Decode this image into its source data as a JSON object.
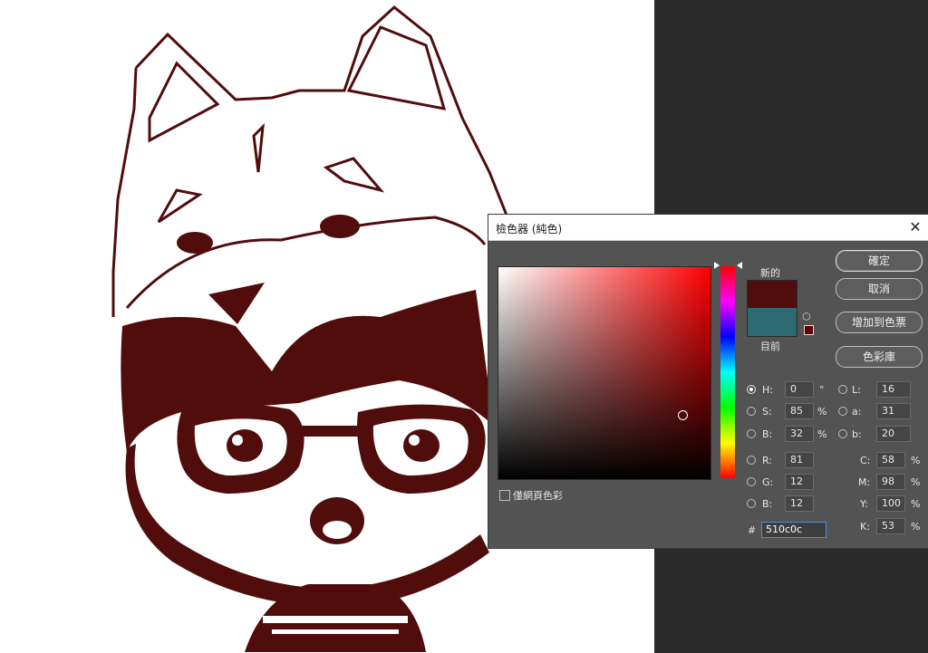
{
  "dialog": {
    "title": "檢色器 (純色)",
    "close_icon": "close-icon",
    "close_glyph": "✕"
  },
  "colors": {
    "new": "#510c0c",
    "current": "#2e6a72",
    "web_safe": "#660000",
    "artwork_stroke": "#510c0c"
  },
  "labels": {
    "new": "新的",
    "current": "目前"
  },
  "buttons": {
    "ok": "確定",
    "cancel": "取消",
    "add_to_swatches": "增加到色票",
    "color_libraries": "色彩庫"
  },
  "hsb": [
    {
      "label": "H:",
      "value": "0",
      "unit": "°",
      "checked": true
    },
    {
      "label": "S:",
      "value": "85",
      "unit": "%",
      "checked": false
    },
    {
      "label": "B:",
      "value": "32",
      "unit": "%",
      "checked": false
    }
  ],
  "lab": [
    {
      "label": "L:",
      "value": "16"
    },
    {
      "label": "a:",
      "value": "31"
    },
    {
      "label": "b:",
      "value": "20"
    }
  ],
  "rgb": [
    {
      "label": "R:",
      "value": "81"
    },
    {
      "label": "G:",
      "value": "12"
    },
    {
      "label": "B:",
      "value": "12"
    }
  ],
  "cmyk": [
    {
      "label": "C:",
      "value": "58",
      "unit": "%"
    },
    {
      "label": "M:",
      "value": "98",
      "unit": "%"
    },
    {
      "label": "Y:",
      "value": "100",
      "unit": "%"
    },
    {
      "label": "K:",
      "value": "53",
      "unit": "%"
    }
  ],
  "hex": {
    "label": "#",
    "value": "510c0c"
  },
  "web_colors_only": {
    "label": "僅網頁色彩",
    "checked": false
  },
  "icons": {
    "cube": "cube-icon",
    "cube_glyph": "⬡"
  }
}
